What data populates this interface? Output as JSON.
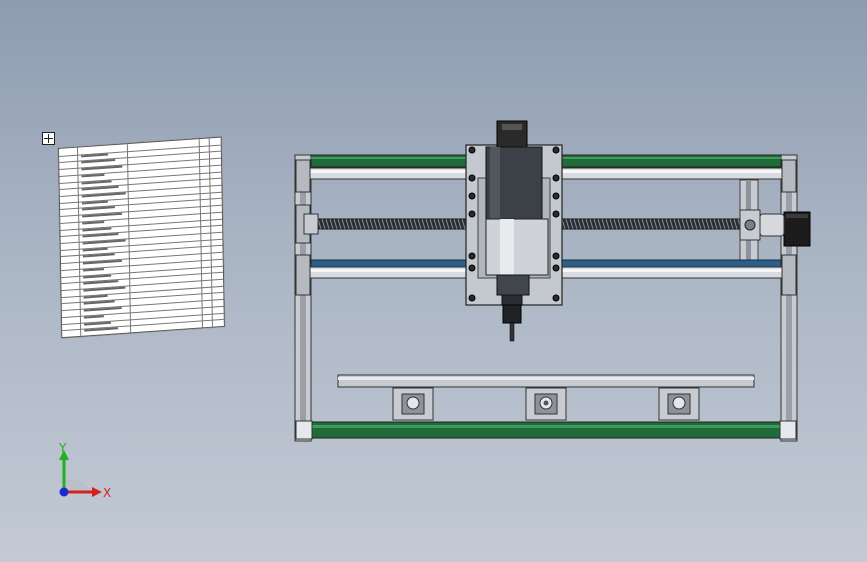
{
  "viewport": {
    "background_top": "#8e9cb0",
    "background_bottom": "#c3cad5"
  },
  "bom": {
    "rows": 28,
    "columns": 4
  },
  "triad": {
    "x_label": "X",
    "y_label": "Y",
    "x_color": "#d62020",
    "y_color": "#20b020",
    "z_color": "#1a2ad0"
  },
  "colors": {
    "frame_green": "#1f6b3a",
    "rail_blue": "#2a5f8a",
    "aluminum": "#c8ccd2",
    "spindle_dark": "#3b4146",
    "motor_black": "#1c1c1c"
  }
}
